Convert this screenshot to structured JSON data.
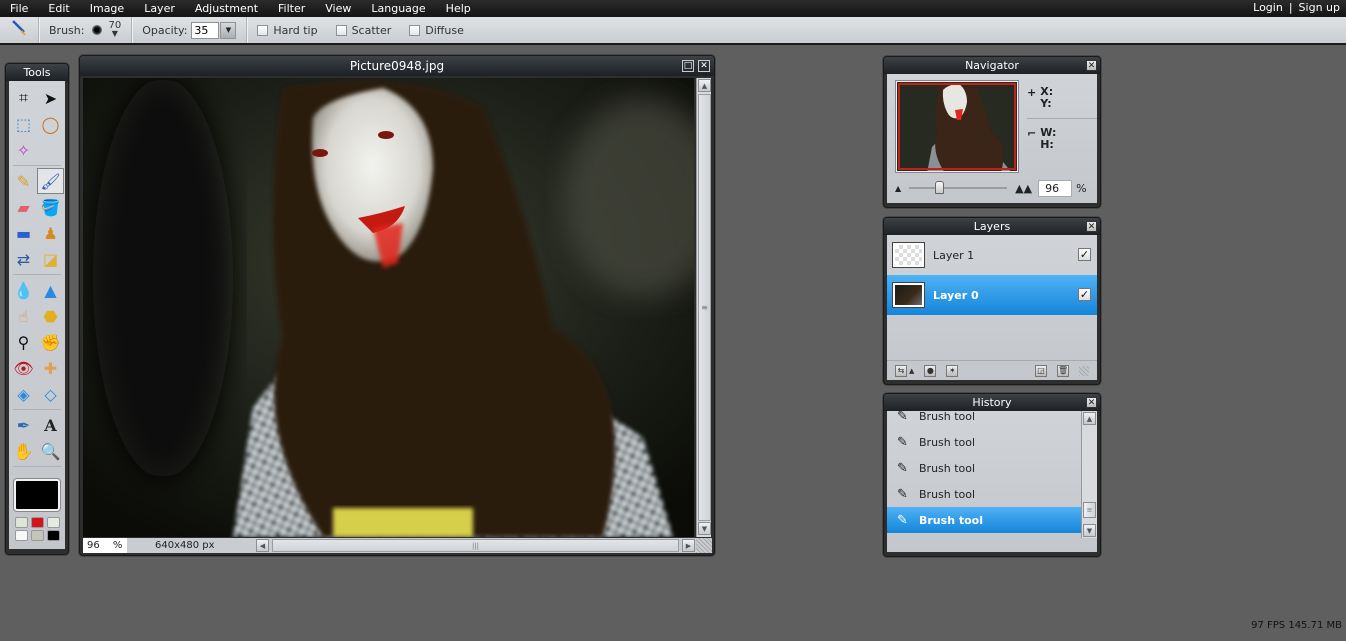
{
  "menubar": {
    "items": [
      "File",
      "Edit",
      "Image",
      "Layer",
      "Adjustment",
      "Filter",
      "View",
      "Language",
      "Help"
    ],
    "login": "Login",
    "separator": "|",
    "signup": "Sign up"
  },
  "options": {
    "active_tool_icon": "brush-icon",
    "brush_label": "Brush:",
    "brush_size": "70",
    "opacity_label": "Opacity:",
    "opacity_value": "35",
    "hard_tip_label": "Hard tip",
    "hard_tip_checked": false,
    "scatter_label": "Scatter",
    "scatter_checked": false,
    "diffuse_label": "Diffuse",
    "diffuse_checked": false
  },
  "tools": {
    "title": "Tools",
    "items": [
      {
        "name": "crop-icon",
        "glyph": "⌗"
      },
      {
        "name": "move-icon",
        "glyph": "➤"
      },
      {
        "name": "marquee-icon",
        "glyph": "⬚"
      },
      {
        "name": "lasso-icon",
        "glyph": "◯"
      },
      {
        "name": "magic-wand-icon",
        "glyph": "✧"
      },
      {
        "name": "pencil-icon",
        "glyph": "✎"
      },
      {
        "name": "brush-icon",
        "glyph": "🖌",
        "active": true
      },
      {
        "name": "eraser-icon",
        "glyph": "▰"
      },
      {
        "name": "paint-bucket-icon",
        "glyph": "🪣"
      },
      {
        "name": "gradient-icon",
        "glyph": "▬"
      },
      {
        "name": "clone-stamp-icon",
        "glyph": "♟"
      },
      {
        "name": "color-replace-icon",
        "glyph": "⇄"
      },
      {
        "name": "shape-icon",
        "glyph": "◪"
      },
      {
        "name": "blur-icon",
        "glyph": "💧"
      },
      {
        "name": "sharpen-icon",
        "glyph": "▲"
      },
      {
        "name": "smudge-icon",
        "glyph": "☝"
      },
      {
        "name": "sponge-icon",
        "glyph": "⬣"
      },
      {
        "name": "dodge-icon",
        "glyph": "⚲"
      },
      {
        "name": "burn-icon",
        "glyph": "✊"
      },
      {
        "name": "red-eye-icon",
        "glyph": "👁"
      },
      {
        "name": "spot-heal-icon",
        "glyph": "✚"
      },
      {
        "name": "bloat-icon",
        "glyph": "◈"
      },
      {
        "name": "pinch-icon",
        "glyph": "◇"
      },
      {
        "name": "color-picker-icon",
        "glyph": "✒"
      },
      {
        "name": "type-icon",
        "glyph": "A"
      },
      {
        "name": "hand-icon",
        "glyph": "✋"
      },
      {
        "name": "zoom-icon",
        "glyph": "🔍"
      }
    ],
    "primary_color": "#000000",
    "swatches": [
      "#dfe5d9",
      "#d4141a",
      "#e6eae3",
      "#f7f8f7",
      "#c2c6bb",
      "#000000"
    ]
  },
  "document": {
    "title": "Picture0948.jpg",
    "zoom": "96",
    "zoom_unit": "%",
    "dimensions": "640x480 px"
  },
  "navigator": {
    "title": "Navigator",
    "x_label": "X:",
    "y_label": "Y:",
    "w_label": "W:",
    "h_label": "H:",
    "zoom_value": "96",
    "zoom_unit": "%",
    "zoom_slider_percent": 96
  },
  "layers": {
    "title": "Layers",
    "items": [
      {
        "name": "Layer 1",
        "visible": true,
        "selected": false
      },
      {
        "name": "Layer 0",
        "visible": true,
        "selected": true
      }
    ]
  },
  "history": {
    "title": "History",
    "items": [
      {
        "label": "Brush tool",
        "selected": false
      },
      {
        "label": "Brush tool",
        "selected": false
      },
      {
        "label": "Brush tool",
        "selected": false
      },
      {
        "label": "Brush tool",
        "selected": false
      },
      {
        "label": "Brush tool",
        "selected": true
      }
    ]
  },
  "status": {
    "fps_memory": "97 FPS 145.71 MB"
  }
}
